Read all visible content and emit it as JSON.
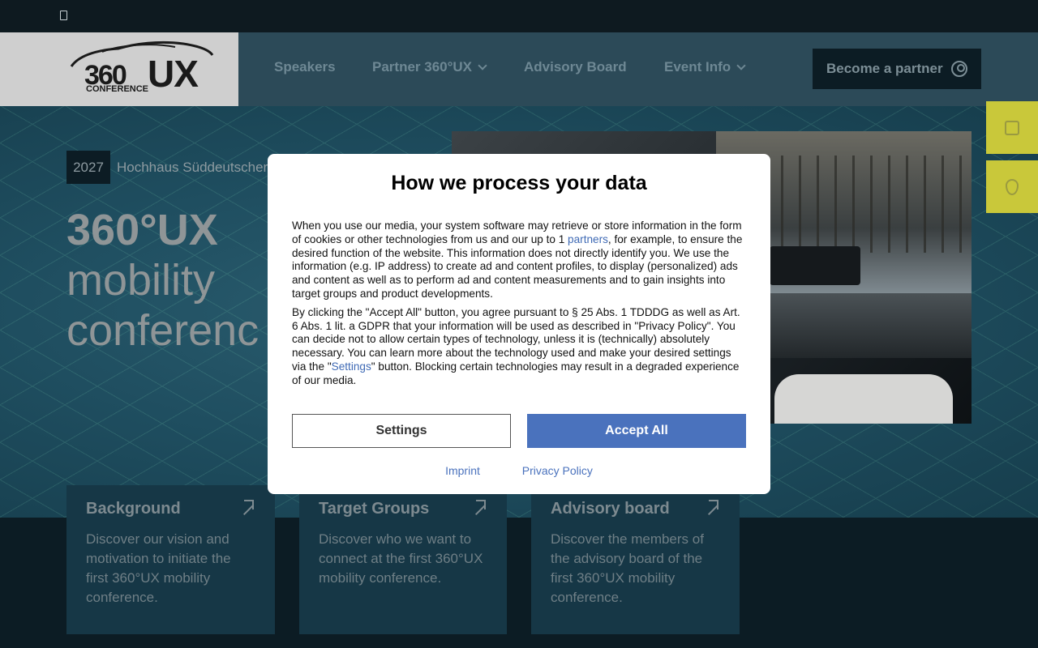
{
  "header": {
    "logo": {
      "text_360": "360",
      "text_ux": "UX",
      "subtitle": "CONFERENCE"
    },
    "nav": [
      {
        "label": "Speakers",
        "dropdown": false
      },
      {
        "label": "Partner 360°UX",
        "dropdown": true
      },
      {
        "label": "Advisory Board",
        "dropdown": false
      },
      {
        "label": "Event Info",
        "dropdown": true
      }
    ],
    "partner_button": "Become a partner"
  },
  "hero": {
    "year": "2027",
    "venue": "Hochhaus Süddeutscher",
    "title_bold": "360°UX",
    "title_line2": "mobility",
    "title_line3": "conferenc"
  },
  "side_tabs": [
    "book-icon",
    "location-pin-icon"
  ],
  "cards": [
    {
      "title": "Background",
      "text": "Discover our vision and motivation to initiate the first 360°UX mobility conference."
    },
    {
      "title": "Target Groups",
      "text": "Discover who we want to connect at the first 360°UX mobility conference."
    },
    {
      "title": "Advisory board",
      "text": "Discover the members of the advisory board of the first 360°UX mobility conference."
    }
  ],
  "consent": {
    "title": "How we process your data",
    "p1_before": "When you use our media, your system software may retrieve or store information in the form of cookies or other technologies from us and our up to 1 ",
    "p1_link": "partners",
    "p1_after": ", for example, to ensure the desired function of the website. This information does not directly identify you. We use the information (e.g. IP address) to create ad and content profiles, to display (personalized) ads and content as well as to perform ad and content measurements and to gain insights into target groups and product developments.",
    "p2_before": "By clicking the \"Accept All\" button, you agree pursuant to § 25 Abs. 1 TDDDG as well as Art. 6 Abs. 1 lit. a GDPR that your information will be used as described in \"Privacy Policy\". You can decide not to allow certain types of technology, unless it is (technically) absolutely necessary. You can learn more about the technology used and make your desired settings via the \"",
    "p2_link": "Settings",
    "p2_after": "\" button. Blocking certain technologies may result in a degraded experience of our media.",
    "settings_label": "Settings",
    "accept_label": "Accept All",
    "imprint_label": "Imprint",
    "privacy_label": "Privacy Policy"
  },
  "colors": {
    "accent_blue": "#4a72bd",
    "side_tab_yellow": "#c9c83a",
    "dark_navy": "#0c1c24"
  }
}
